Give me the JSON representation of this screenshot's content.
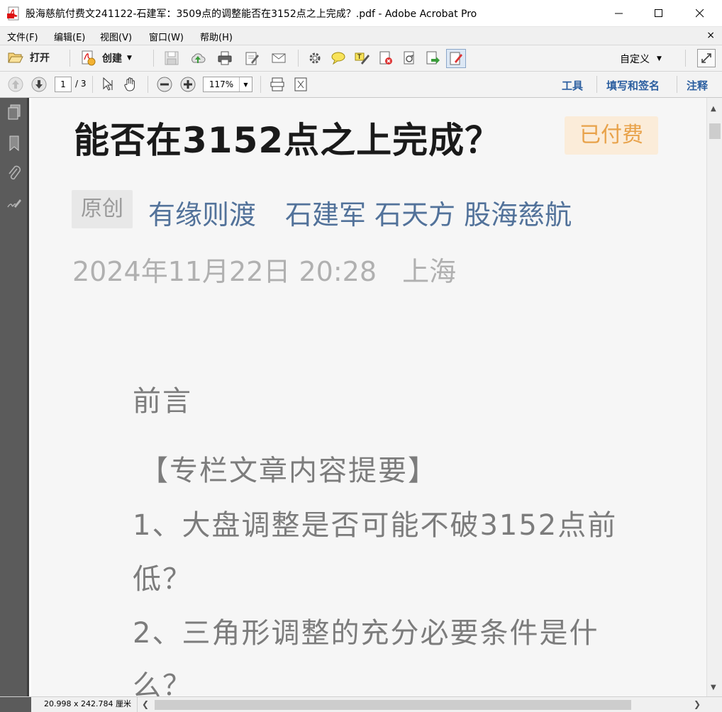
{
  "window": {
    "title": "股海慈航付费文241122-石建军：3509点的调整能否在3152点之上完成？.pdf - Adobe Acrobat Pro"
  },
  "menu": {
    "items": [
      "文件(F)",
      "编辑(E)",
      "视图(V)",
      "窗口(W)",
      "帮助(H)"
    ],
    "close": "×"
  },
  "toolbar": {
    "open_label": "打开",
    "create_label": "创建",
    "customize_label": "自定义"
  },
  "nav": {
    "current_page": "1",
    "total_pages": "/ 3",
    "zoom": "117%"
  },
  "panels": {
    "tools": "工具",
    "fill_sign": "填写和签名",
    "comment": "注释"
  },
  "document": {
    "title_line": "能否在3152点之上完成？",
    "paid_badge": "已付费",
    "original_badge": "原创",
    "author_1": "有缘则渡",
    "author_2": "石建军 石天方 股海慈航",
    "date": "2024年11月22日 20:28",
    "location": "上海",
    "preface": "前言",
    "summary_heading": "【专栏文章内容提要】",
    "item_1_line_1": "1、大盘调整是否可能不破3152点前",
    "item_1_line_2": "低？",
    "item_2_line_1": "2、三角形调整的充分必要条件是什",
    "item_2_line_2": "么？"
  },
  "status": {
    "page_size": "20.998 x 242.784 厘米"
  }
}
